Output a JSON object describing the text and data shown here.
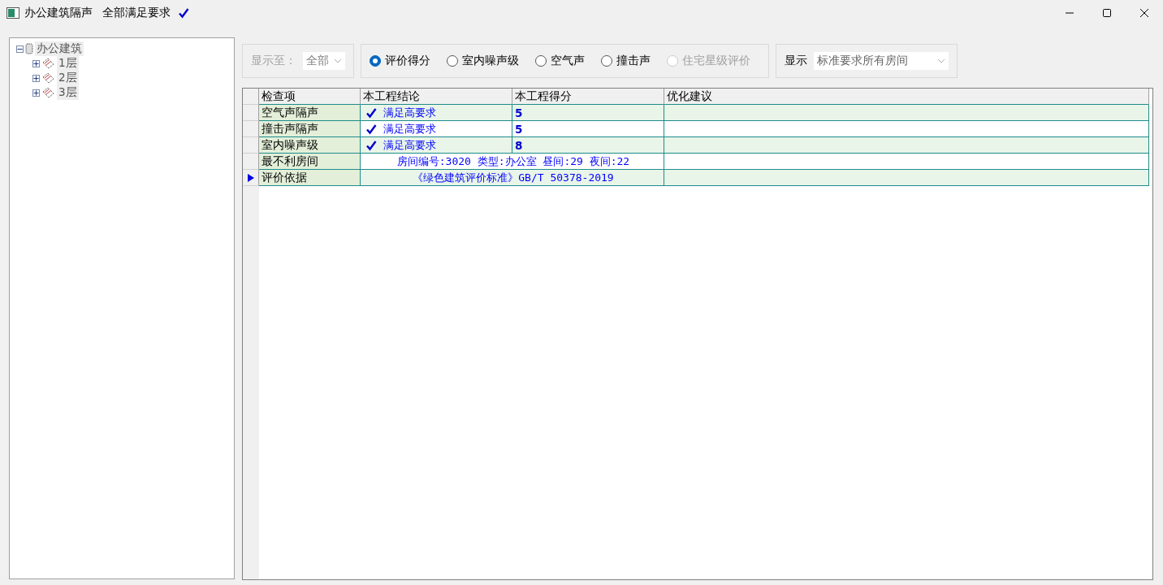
{
  "window": {
    "title": "办公建筑隔声",
    "status": "全部满足要求"
  },
  "tree": {
    "label": "办公建筑",
    "expanded": true,
    "children": [
      {
        "label": "1层",
        "expanded": false
      },
      {
        "label": "2层",
        "expanded": false
      },
      {
        "label": "3层",
        "expanded": false
      }
    ]
  },
  "range": {
    "label": "显示至：",
    "value": "全部",
    "disabled": true
  },
  "modes": [
    {
      "label": "评价得分",
      "selected": true,
      "disabled": false
    },
    {
      "label": "室内噪声级",
      "selected": false,
      "disabled": false
    },
    {
      "label": "空气声",
      "selected": false,
      "disabled": false
    },
    {
      "label": "撞击声",
      "selected": false,
      "disabled": false
    },
    {
      "label": "住宅星级评价",
      "selected": false,
      "disabled": true
    }
  ],
  "display": {
    "label": "显示",
    "value": "标准要求所有房间"
  },
  "table": {
    "columns": [
      "检查项",
      "本工程结论",
      "本工程得分",
      "优化建议"
    ],
    "rows": [
      {
        "item": "空气声隔声",
        "conclusion": "满足高要求",
        "check": true,
        "score": "5",
        "current": false
      },
      {
        "item": "撞击声隔声",
        "conclusion": "满足高要求",
        "check": true,
        "score": "5",
        "current": false
      },
      {
        "item": "室内噪声级",
        "conclusion": "满足高要求",
        "check": true,
        "score": "8",
        "current": false
      },
      {
        "item": "最不利房间",
        "conclusion": "房间编号:3020 类型:办公室 昼间:29 夜间:22",
        "check": false,
        "current": false
      },
      {
        "item": "评价依据",
        "conclusion": "《绿色建筑评价标准》GB/T 50378-2019",
        "check": false,
        "current": true
      }
    ]
  }
}
